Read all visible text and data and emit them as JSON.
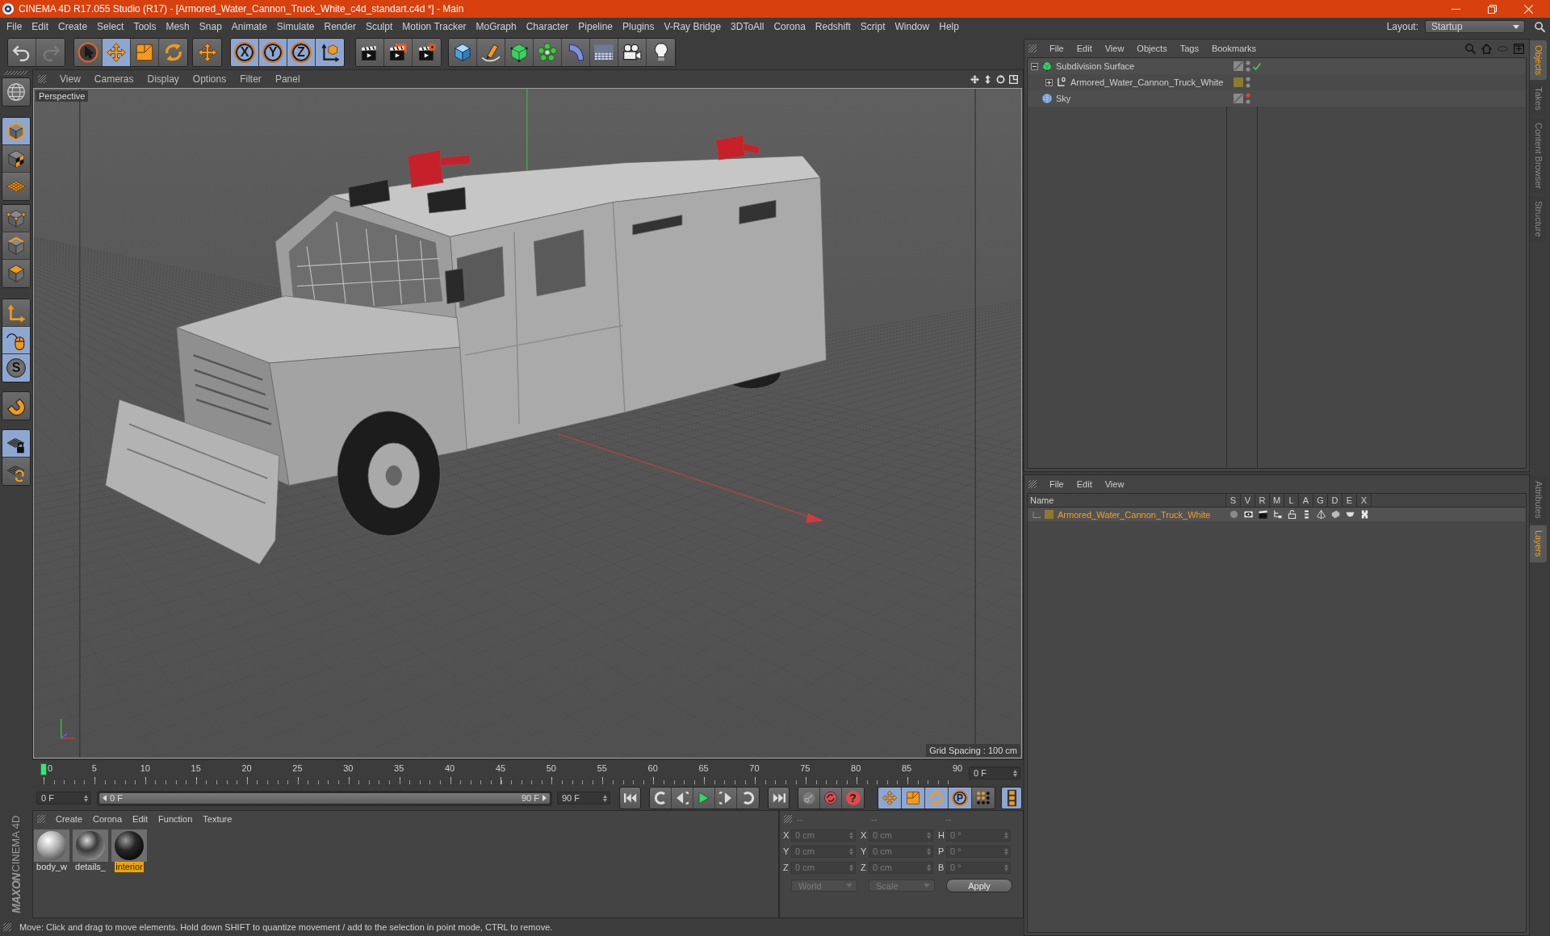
{
  "window": {
    "title": "CINEMA 4D R17.055 Studio (R17) - [Armored_Water_Cannon_Truck_White_c4d_standart.c4d *] - Main"
  },
  "menu_bar": [
    "File",
    "Edit",
    "Create",
    "Select",
    "Tools",
    "Mesh",
    "Snap",
    "Animate",
    "Simulate",
    "Render",
    "Sculpt",
    "Motion Tracker",
    "MoGraph",
    "Character",
    "Pipeline",
    "Plugins",
    "V-Ray Bridge",
    "3DToAll",
    "Corona",
    "Redshift",
    "Script",
    "Window",
    "Help"
  ],
  "layout": {
    "label": "Layout:",
    "value": "Startup"
  },
  "toolbar": [
    {
      "buttons": [
        {
          "kind": "undo",
          "selected": false,
          "disabled": false
        },
        {
          "kind": "redo",
          "selected": false,
          "disabled": true
        }
      ]
    },
    {
      "buttons": [
        {
          "kind": "live-select",
          "selected": false,
          "disabled": false
        },
        {
          "kind": "move",
          "selected": true,
          "disabled": false
        },
        {
          "kind": "scale",
          "selected": false,
          "disabled": false
        },
        {
          "kind": "rotate",
          "selected": false,
          "disabled": false
        }
      ]
    },
    {
      "buttons": [
        {
          "kind": "move",
          "selected": false,
          "disabled": false
        }
      ]
    },
    {
      "buttons": [
        {
          "kind": "axis",
          "label": "X",
          "selected": true,
          "disabled": false
        },
        {
          "kind": "axis",
          "label": "Y",
          "selected": true,
          "disabled": false
        },
        {
          "kind": "axis",
          "label": "Z",
          "selected": true,
          "disabled": false
        },
        {
          "kind": "world",
          "selected": true,
          "disabled": false
        }
      ]
    },
    {
      "buttons": [
        {
          "kind": "render-view",
          "selected": false,
          "disabled": false
        },
        {
          "kind": "render-viewer",
          "selected": false,
          "disabled": false
        },
        {
          "kind": "render-settings",
          "selected": false,
          "disabled": false
        }
      ]
    },
    {
      "buttons": [
        {
          "kind": "cube",
          "selected": false,
          "disabled": false
        },
        {
          "kind": "pen",
          "selected": false,
          "disabled": false
        },
        {
          "kind": "subdivision",
          "selected": false,
          "disabled": false
        },
        {
          "kind": "cloner",
          "selected": false,
          "disabled": false
        },
        {
          "kind": "bend",
          "selected": false,
          "disabled": false
        },
        {
          "kind": "floor",
          "selected": false,
          "disabled": false
        },
        {
          "kind": "camera",
          "selected": false,
          "disabled": false
        },
        {
          "kind": "light",
          "selected": false,
          "disabled": false
        }
      ]
    }
  ],
  "tool_palette": [
    {
      "buttons": [
        {
          "kind": "make-editable",
          "selected": false
        }
      ]
    },
    {
      "buttons": [
        {
          "kind": "model",
          "selected": true
        },
        {
          "kind": "texture",
          "selected": false
        },
        {
          "kind": "workplane",
          "selected": false
        }
      ]
    },
    {
      "buttons": [
        {
          "kind": "points",
          "selected": false
        },
        {
          "kind": "edges",
          "selected": false
        },
        {
          "kind": "polygons",
          "selected": false
        }
      ]
    },
    {
      "buttons": [
        {
          "kind": "axis-mode",
          "selected": false
        },
        {
          "kind": "tweak",
          "selected": true
        },
        {
          "kind": "solo",
          "label": "S",
          "selected": true
        }
      ]
    },
    {
      "buttons": [
        {
          "kind": "snap",
          "selected": false
        }
      ]
    },
    {
      "buttons": [
        {
          "kind": "lock-workplane",
          "selected": true
        },
        {
          "kind": "align-workplane",
          "selected": false
        }
      ]
    }
  ],
  "brand": {
    "company": "MAXON",
    "product": "CINEMA 4D"
  },
  "viewport": {
    "menu": [
      "View",
      "Cameras",
      "Display",
      "Options",
      "Filter",
      "Panel"
    ],
    "camera": "Perspective",
    "grid_spacing": "Grid Spacing : 100 cm"
  },
  "timeline": {
    "labels": [
      "0",
      "5",
      "10",
      "15",
      "20",
      "25",
      "30",
      "35",
      "40",
      "45",
      "50",
      "55",
      "60",
      "65",
      "70",
      "75",
      "80",
      "85",
      "90"
    ],
    "level": 0,
    "current": "0 F"
  },
  "transport": {
    "start": "0 F",
    "range": {
      "start": "0 F",
      "end": "90 F",
      "level": 1
    },
    "end": "90 F",
    "key_selection": "?",
    "key_filters": [
      {
        "kind": "position",
        "selected": true
      },
      {
        "kind": "scale",
        "selected": true
      },
      {
        "kind": "rotation",
        "selected": true
      },
      {
        "kind": "parameter",
        "label": "P",
        "selected": true
      },
      {
        "kind": "point-level",
        "selected": false
      }
    ],
    "timeline_button": {
      "selected": true
    }
  },
  "material_manager": {
    "menu": [
      "Create",
      "Corona",
      "Edit",
      "Function",
      "Texture"
    ],
    "materials": [
      {
        "name": "body_w",
        "kind": "white",
        "selected": false
      },
      {
        "name": "details_",
        "kind": "chrome",
        "selected": false
      },
      {
        "name": "interior",
        "kind": "dark",
        "selected": true
      }
    ]
  },
  "coordinates": {
    "disabled": true,
    "headers": [
      "--",
      "--",
      "--"
    ],
    "rows": [
      {
        "position_axis": "X",
        "position": "0 cm",
        "size_axis": "X",
        "size": "0 cm",
        "rotation_axis": "H",
        "rotation": "0 °"
      },
      {
        "position_axis": "Y",
        "position": "0 cm",
        "size_axis": "Y",
        "size": "0 cm",
        "rotation_axis": "P",
        "rotation": "0 °"
      },
      {
        "position_axis": "Z",
        "position": "0 cm",
        "size_axis": "Z",
        "size": "0 cm",
        "rotation_axis": "B",
        "rotation": "0 °"
      }
    ],
    "mode": "World",
    "size_mode": "Scale",
    "apply": "Apply"
  },
  "status_bar": {
    "text": "Move: Click and drag to move elements. Hold down SHIFT to quantize movement / add to the selection in point mode, CTRL to remove."
  },
  "object_manager": {
    "menu": [
      "File",
      "Edit",
      "View",
      "Objects",
      "Tags",
      "Bookmarks"
    ],
    "objects": [
      {
        "name": "Subdivision Surface",
        "kind": "subdivision",
        "expanded": true,
        "enabled": true,
        "editor_hidden": false,
        "render_hidden": false,
        "children": [
          {
            "name": "Armored_Water_Cannon_Truck_White",
            "kind": "null",
            "expanded": false,
            "color": "#8c7a2e",
            "editor_hidden": false,
            "render_hidden": false
          }
        ]
      },
      {
        "name": "Sky",
        "kind": "sky",
        "editor_hidden": true,
        "render_hidden": false
      }
    ]
  },
  "layer_manager": {
    "menu": [
      "File",
      "Edit",
      "View"
    ],
    "columns": [
      "Name",
      "S",
      "V",
      "R",
      "M",
      "L",
      "A",
      "G",
      "D",
      "E",
      "X"
    ],
    "layers": [
      {
        "name": "Armored_Water_Cannon_Truck_White",
        "color": "#8c7a2e",
        "selected": true
      }
    ]
  },
  "side_tabs": {
    "top": [
      {
        "label": "Objects",
        "selected": true
      },
      {
        "label": "Takes",
        "selected": false
      },
      {
        "label": "Content Browser",
        "selected": false
      },
      {
        "label": "Structure",
        "selected": false
      }
    ],
    "bottom": [
      {
        "label": "Attributes",
        "selected": false
      },
      {
        "label": "Layers",
        "selected": true
      }
    ]
  }
}
